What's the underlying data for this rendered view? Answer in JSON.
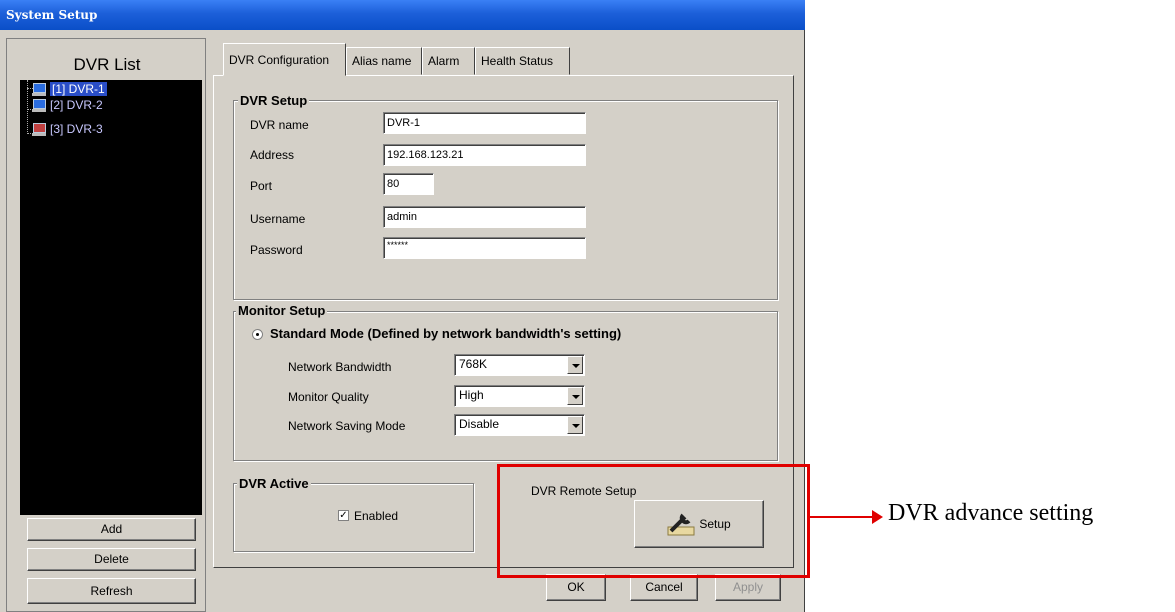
{
  "window": {
    "title": "System Setup"
  },
  "sidebar": {
    "title": "DVR List",
    "items": [
      {
        "label": "[1] DVR-1",
        "icon": "computer-icon",
        "selected": true
      },
      {
        "label": "[2] DVR-2",
        "icon": "computer-icon",
        "selected": false
      },
      {
        "label": "[3] DVR-3",
        "icon": "computer-error-icon",
        "selected": false
      }
    ],
    "buttons": {
      "add": "Add",
      "delete": "Delete",
      "refresh": "Refresh"
    }
  },
  "tabs": [
    {
      "label": "DVR Configuration",
      "active": true
    },
    {
      "label": "Alias name",
      "active": false
    },
    {
      "label": "Alarm",
      "active": false
    },
    {
      "label": "Health Status",
      "active": false
    }
  ],
  "dvr_setup": {
    "title": "DVR Setup",
    "name_label": "DVR name",
    "name_value": "DVR-1",
    "address_label": "Address",
    "address_value": "192.168.123.21",
    "port_label": "Port",
    "port_value": "80",
    "username_label": "Username",
    "username_value": "admin",
    "password_label": "Password",
    "password_value": "******"
  },
  "monitor_setup": {
    "title": "Monitor Setup",
    "mode_label": "Standard Mode (Defined by network bandwidth's setting)",
    "bandwidth_label": "Network Bandwidth",
    "bandwidth_value": "768K",
    "quality_label": "Monitor Quality",
    "quality_value": "High",
    "saving_label": "Network Saving Mode",
    "saving_value": "Disable"
  },
  "dvr_active": {
    "title": "DVR Active",
    "enabled_label": "Enabled",
    "enabled": true
  },
  "remote_setup": {
    "label": "DVR Remote Setup",
    "button": "Setup"
  },
  "footer": {
    "ok": "OK",
    "cancel": "Cancel",
    "apply": "Apply"
  },
  "annotation": {
    "text": "DVR advance setting",
    "color": "#e00000"
  }
}
